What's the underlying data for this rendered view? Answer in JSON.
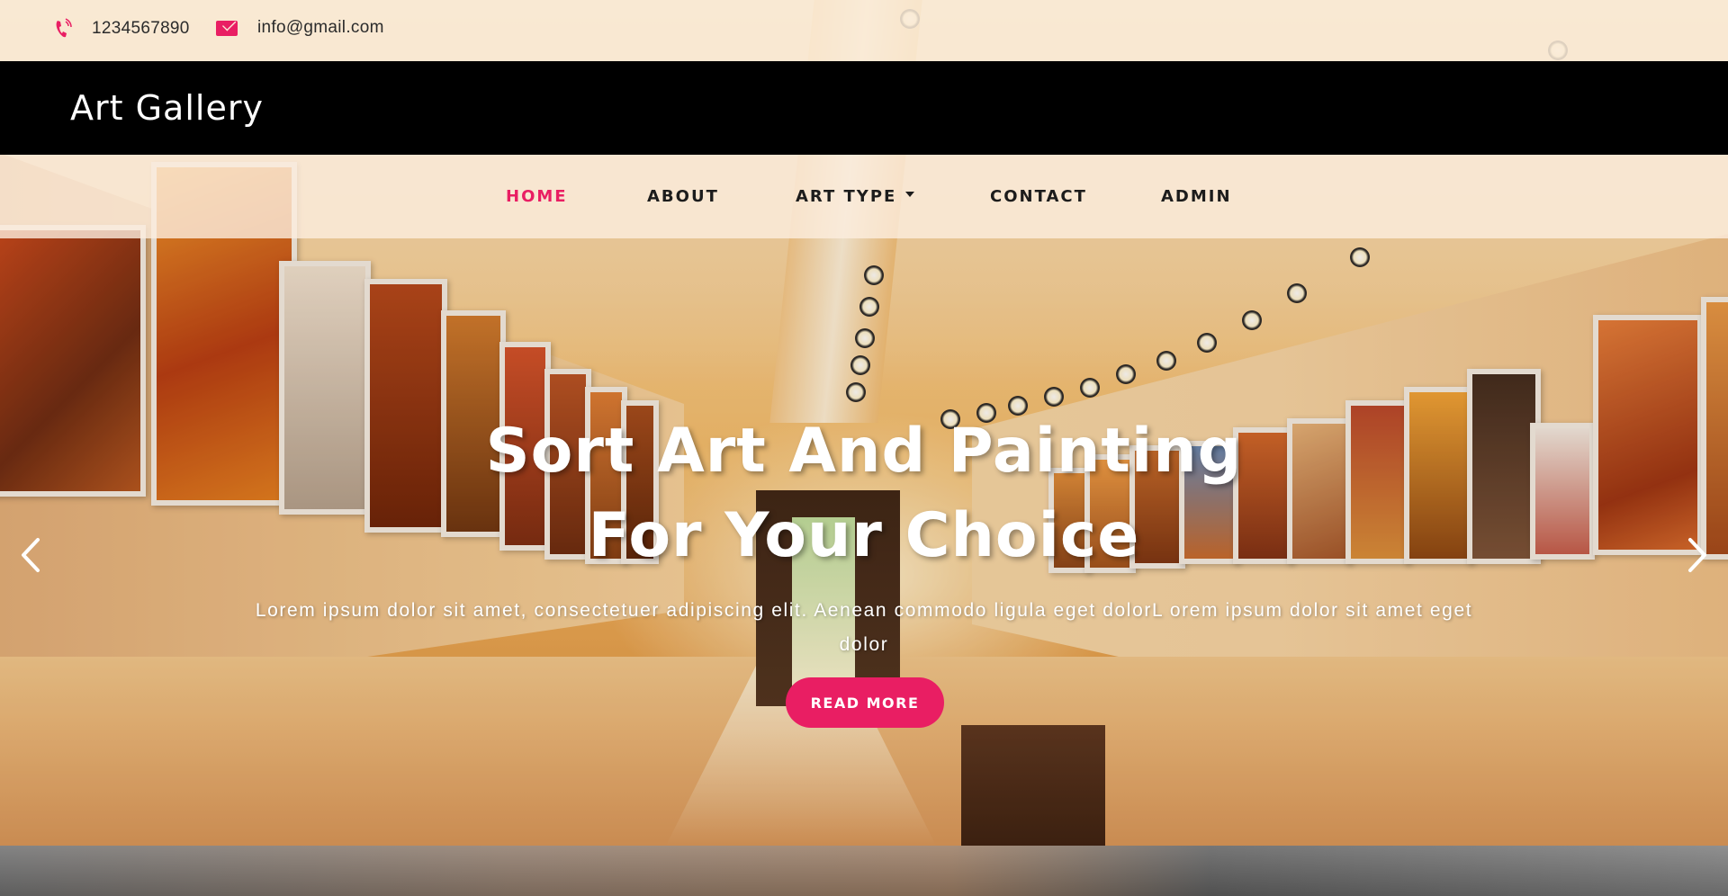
{
  "topbar": {
    "phone": "1234567890",
    "email": "info@gmail.com",
    "phone_icon": "phone-icon",
    "email_icon": "envelope-icon"
  },
  "brand": {
    "title": "Art Gallery"
  },
  "nav": {
    "items": [
      {
        "label": "HOME",
        "active": true
      },
      {
        "label": "ABOUT",
        "active": false
      },
      {
        "label": "ART TYPE",
        "active": false,
        "has_dropdown": true
      },
      {
        "label": "CONTACT",
        "active": false
      },
      {
        "label": "ADMIN",
        "active": false
      }
    ]
  },
  "hero": {
    "title_line1": "Sort Art And Painting",
    "title_line2": "For Your Choice",
    "text": "Lorem ipsum dolor sit amet, consectetuer adipiscing elit. Aenean commodo ligula eget dolorL orem ipsum dolor sit amet eget dolor",
    "button_label": "READ MORE",
    "prev_icon": "chevron-left-icon",
    "next_icon": "chevron-right-icon"
  },
  "colors": {
    "accent": "#e91e63",
    "brandbar": "#000000",
    "text_light": "#ffffff"
  }
}
